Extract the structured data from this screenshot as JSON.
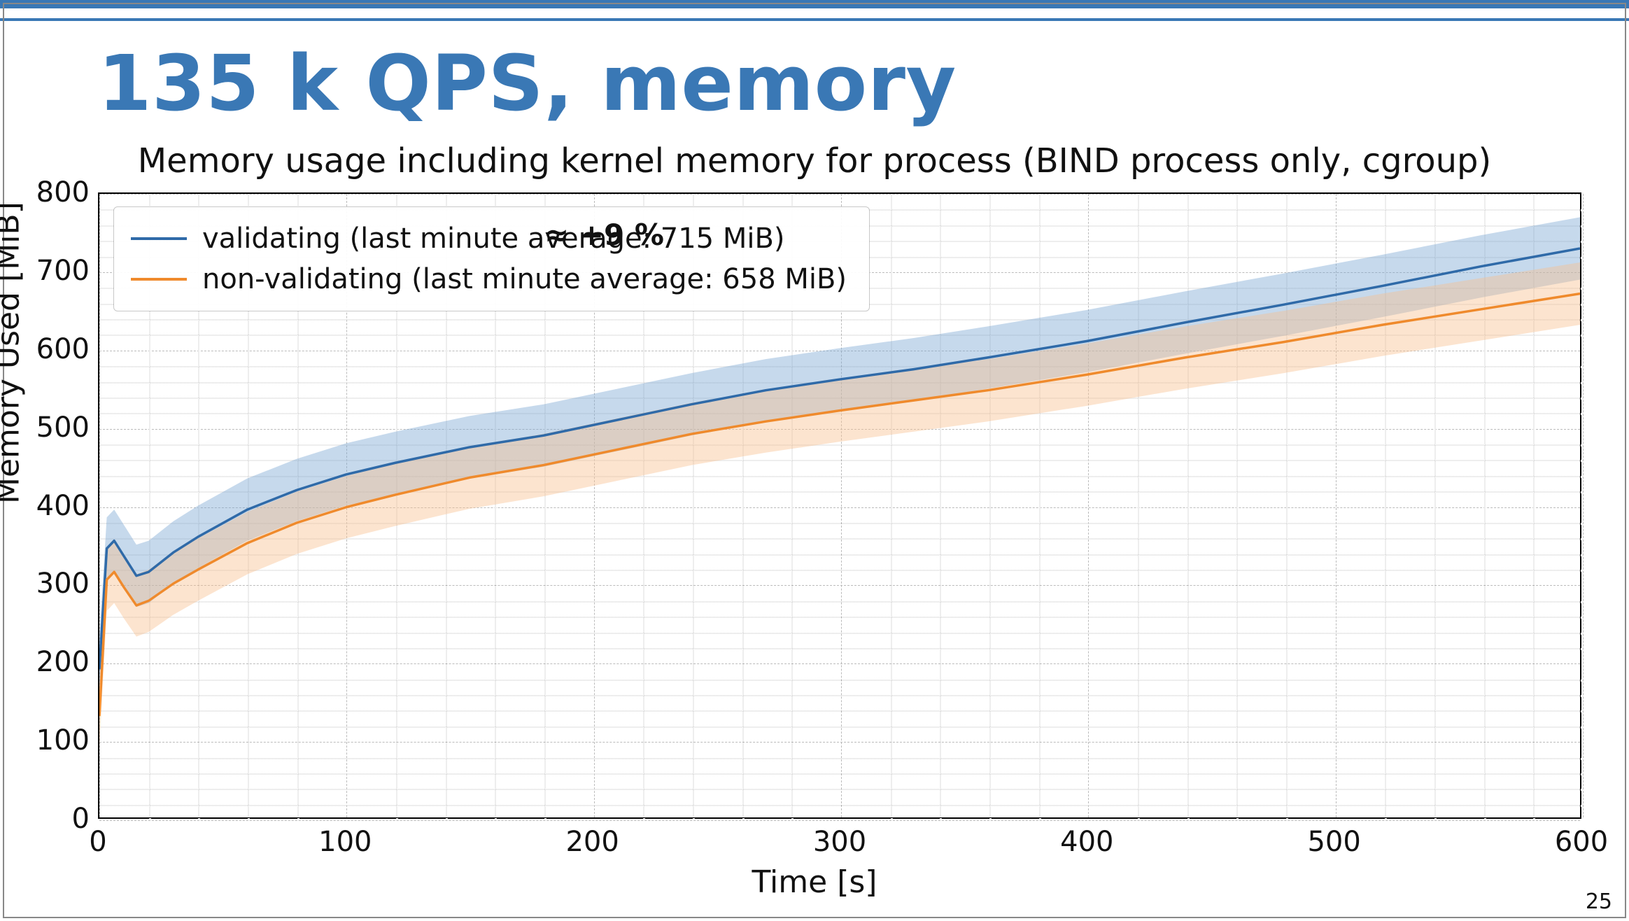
{
  "slide": {
    "title": "135 k QPS, memory",
    "page_number": "25"
  },
  "chart_data": {
    "type": "line",
    "title": "Memory usage including kernel memory for process (BIND process only, cgroup)",
    "xlabel": "Time [s]",
    "ylabel": "Memory Used [MiB]",
    "xlim": [
      0,
      600
    ],
    "ylim": [
      0,
      800
    ],
    "x_ticks": [
      0,
      100,
      200,
      300,
      400,
      500,
      600
    ],
    "y_ticks": [
      0,
      100,
      200,
      300,
      400,
      500,
      600,
      700,
      800
    ],
    "annotation": "≈ +9 %",
    "annotation_pos": {
      "x": 180,
      "y": 770
    },
    "legend": [
      "validating (last minute average: 715 MiB)",
      "non-validating (last minute average: 658 MiB)"
    ],
    "series": [
      {
        "name": "validating",
        "color": "#2f6aa8",
        "band_color": "rgba(120,165,210,0.42)",
        "x": [
          0,
          3,
          6,
          10,
          15,
          20,
          30,
          40,
          60,
          80,
          100,
          120,
          150,
          180,
          210,
          240,
          270,
          300,
          330,
          360,
          400,
          440,
          480,
          520,
          560,
          600
        ],
        "values": [
          190,
          345,
          355,
          335,
          310,
          315,
          340,
          360,
          395,
          420,
          440,
          455,
          475,
          490,
          510,
          530,
          548,
          562,
          575,
          590,
          611,
          635,
          658,
          682,
          707,
          730
        ],
        "band_width": 40
      },
      {
        "name": "non-validating",
        "color": "#ef8a2c",
        "band_color": "rgba(248,190,140,0.42)",
        "x": [
          0,
          3,
          6,
          10,
          15,
          20,
          30,
          40,
          60,
          80,
          100,
          120,
          150,
          180,
          210,
          240,
          270,
          300,
          330,
          360,
          400,
          440,
          480,
          520,
          560,
          600
        ],
        "values": [
          130,
          305,
          315,
          295,
          272,
          278,
          300,
          318,
          352,
          378,
          398,
          414,
          436,
          452,
          472,
          492,
          508,
          522,
          535,
          548,
          568,
          590,
          610,
          632,
          652,
          672
        ],
        "band_width": 40
      }
    ]
  }
}
